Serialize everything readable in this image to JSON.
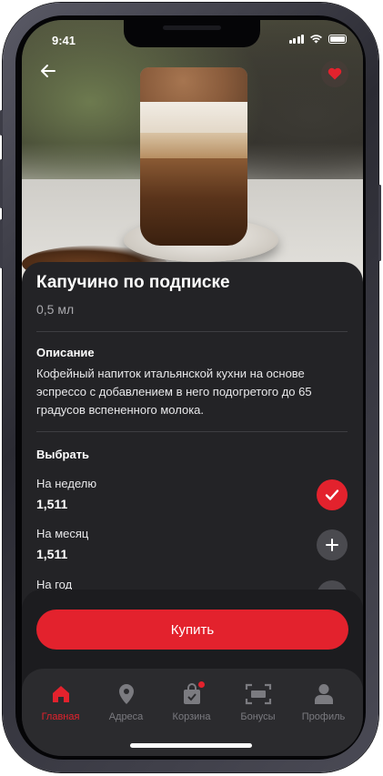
{
  "status_bar": {
    "time": "9:41"
  },
  "product": {
    "title": "Капучино по подписке",
    "volume": "0,5 мл"
  },
  "description": {
    "heading": "Описание",
    "text": "Кофейный напиток итальянской кухни на основе эспрессо с добавлением в него подогретого до 65 градусов вспененного молока."
  },
  "choose": {
    "heading": "Выбрать",
    "options": [
      {
        "label": "На неделю",
        "price": "1,511",
        "state": "selected"
      },
      {
        "label": "На месяц",
        "price": "1,511",
        "state": "add"
      },
      {
        "label": "На год",
        "price": "",
        "state": "add"
      }
    ]
  },
  "buy_button": {
    "label": "Купить"
  },
  "tabbar": {
    "items": [
      {
        "label": "Главная",
        "icon": "home-icon",
        "active": true
      },
      {
        "label": "Адреса",
        "icon": "map-pin-icon"
      },
      {
        "label": "Корзина",
        "icon": "shopping-bag-icon",
        "badge": true
      },
      {
        "label": "Бонусы",
        "icon": "barcode-scan-icon"
      },
      {
        "label": "Профиль",
        "icon": "user-icon"
      }
    ]
  },
  "colors": {
    "accent": "#e3222d",
    "panel": "#232326",
    "inactive": "#7b7b80"
  }
}
